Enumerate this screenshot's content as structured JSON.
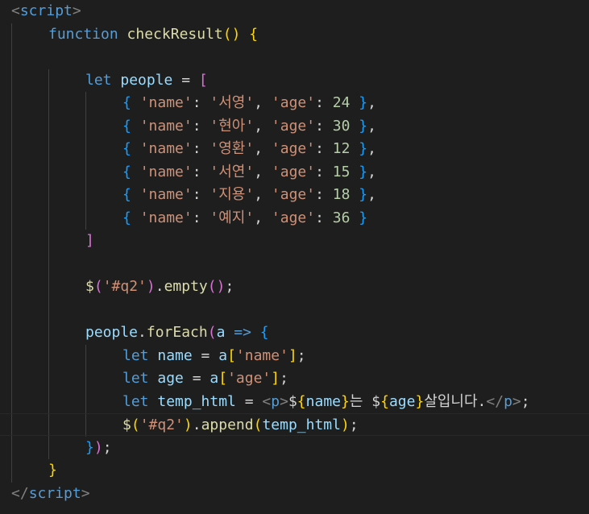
{
  "editor": {
    "colors": {
      "background": "#1e1e1e",
      "tag_bracket": "#808080",
      "tag": "#569cd6",
      "keyword": "#569cd6",
      "function": "#dcdcaa",
      "variable": "#9cdcfe",
      "string": "#ce9178",
      "number": "#b5cea8",
      "text": "#d4d4d4",
      "bracket_gold": "#ffd700",
      "bracket_purple": "#da70d6",
      "bracket_blue": "#179fff"
    },
    "lines": [
      {
        "indent": 0,
        "tokens": [
          {
            "t": "<",
            "c": "tag_bracket"
          },
          {
            "t": "script",
            "c": "tag"
          },
          {
            "t": ">",
            "c": "tag_bracket"
          }
        ]
      },
      {
        "indent": 1,
        "tokens": [
          {
            "t": "function",
            "c": "keyword"
          },
          {
            "t": " ",
            "c": "text"
          },
          {
            "t": "checkResult",
            "c": "function"
          },
          {
            "t": "()",
            "c": "bracket_gold"
          },
          {
            "t": " ",
            "c": "text"
          },
          {
            "t": "{",
            "c": "bracket_gold"
          }
        ]
      },
      {
        "indent": 0,
        "tokens": []
      },
      {
        "indent": 2,
        "tokens": [
          {
            "t": "let",
            "c": "keyword"
          },
          {
            "t": " ",
            "c": "text"
          },
          {
            "t": "people",
            "c": "variable"
          },
          {
            "t": " = ",
            "c": "text"
          },
          {
            "t": "[",
            "c": "bracket_purple"
          }
        ]
      },
      {
        "indent": 3,
        "tokens": [
          {
            "t": "{",
            "c": "bracket_blue"
          },
          {
            "t": " ",
            "c": "text"
          },
          {
            "t": "'name'",
            "c": "string"
          },
          {
            "t": ": ",
            "c": "text"
          },
          {
            "t": "'서영'",
            "c": "string"
          },
          {
            "t": ", ",
            "c": "text"
          },
          {
            "t": "'age'",
            "c": "string"
          },
          {
            "t": ": ",
            "c": "text"
          },
          {
            "t": "24",
            "c": "number"
          },
          {
            "t": " ",
            "c": "text"
          },
          {
            "t": "}",
            "c": "bracket_blue"
          },
          {
            "t": ",",
            "c": "text"
          }
        ]
      },
      {
        "indent": 3,
        "tokens": [
          {
            "t": "{",
            "c": "bracket_blue"
          },
          {
            "t": " ",
            "c": "text"
          },
          {
            "t": "'name'",
            "c": "string"
          },
          {
            "t": ": ",
            "c": "text"
          },
          {
            "t": "'현아'",
            "c": "string"
          },
          {
            "t": ", ",
            "c": "text"
          },
          {
            "t": "'age'",
            "c": "string"
          },
          {
            "t": ": ",
            "c": "text"
          },
          {
            "t": "30",
            "c": "number"
          },
          {
            "t": " ",
            "c": "text"
          },
          {
            "t": "}",
            "c": "bracket_blue"
          },
          {
            "t": ",",
            "c": "text"
          }
        ]
      },
      {
        "indent": 3,
        "tokens": [
          {
            "t": "{",
            "c": "bracket_blue"
          },
          {
            "t": " ",
            "c": "text"
          },
          {
            "t": "'name'",
            "c": "string"
          },
          {
            "t": ": ",
            "c": "text"
          },
          {
            "t": "'영환'",
            "c": "string"
          },
          {
            "t": ", ",
            "c": "text"
          },
          {
            "t": "'age'",
            "c": "string"
          },
          {
            "t": ": ",
            "c": "text"
          },
          {
            "t": "12",
            "c": "number"
          },
          {
            "t": " ",
            "c": "text"
          },
          {
            "t": "}",
            "c": "bracket_blue"
          },
          {
            "t": ",",
            "c": "text"
          }
        ]
      },
      {
        "indent": 3,
        "tokens": [
          {
            "t": "{",
            "c": "bracket_blue"
          },
          {
            "t": " ",
            "c": "text"
          },
          {
            "t": "'name'",
            "c": "string"
          },
          {
            "t": ": ",
            "c": "text"
          },
          {
            "t": "'서연'",
            "c": "string"
          },
          {
            "t": ", ",
            "c": "text"
          },
          {
            "t": "'age'",
            "c": "string"
          },
          {
            "t": ": ",
            "c": "text"
          },
          {
            "t": "15",
            "c": "number"
          },
          {
            "t": " ",
            "c": "text"
          },
          {
            "t": "}",
            "c": "bracket_blue"
          },
          {
            "t": ",",
            "c": "text"
          }
        ]
      },
      {
        "indent": 3,
        "tokens": [
          {
            "t": "{",
            "c": "bracket_blue"
          },
          {
            "t": " ",
            "c": "text"
          },
          {
            "t": "'name'",
            "c": "string"
          },
          {
            "t": ": ",
            "c": "text"
          },
          {
            "t": "'지용'",
            "c": "string"
          },
          {
            "t": ", ",
            "c": "text"
          },
          {
            "t": "'age'",
            "c": "string"
          },
          {
            "t": ": ",
            "c": "text"
          },
          {
            "t": "18",
            "c": "number"
          },
          {
            "t": " ",
            "c": "text"
          },
          {
            "t": "}",
            "c": "bracket_blue"
          },
          {
            "t": ",",
            "c": "text"
          }
        ]
      },
      {
        "indent": 3,
        "tokens": [
          {
            "t": "{",
            "c": "bracket_blue"
          },
          {
            "t": " ",
            "c": "text"
          },
          {
            "t": "'name'",
            "c": "string"
          },
          {
            "t": ": ",
            "c": "text"
          },
          {
            "t": "'예지'",
            "c": "string"
          },
          {
            "t": ", ",
            "c": "text"
          },
          {
            "t": "'age'",
            "c": "string"
          },
          {
            "t": ": ",
            "c": "text"
          },
          {
            "t": "36",
            "c": "number"
          },
          {
            "t": " ",
            "c": "text"
          },
          {
            "t": "}",
            "c": "bracket_blue"
          }
        ]
      },
      {
        "indent": 2,
        "tokens": [
          {
            "t": "]",
            "c": "bracket_purple"
          }
        ]
      },
      {
        "indent": 0,
        "tokens": []
      },
      {
        "indent": 2,
        "tokens": [
          {
            "t": "$",
            "c": "function"
          },
          {
            "t": "(",
            "c": "bracket_purple"
          },
          {
            "t": "'#q2'",
            "c": "string"
          },
          {
            "t": ")",
            "c": "bracket_purple"
          },
          {
            "t": ".",
            "c": "text"
          },
          {
            "t": "empty",
            "c": "function"
          },
          {
            "t": "()",
            "c": "bracket_purple"
          },
          {
            "t": ";",
            "c": "text"
          }
        ]
      },
      {
        "indent": 0,
        "tokens": []
      },
      {
        "indent": 2,
        "tokens": [
          {
            "t": "people",
            "c": "variable"
          },
          {
            "t": ".",
            "c": "text"
          },
          {
            "t": "forEach",
            "c": "function"
          },
          {
            "t": "(",
            "c": "bracket_purple"
          },
          {
            "t": "a",
            "c": "variable"
          },
          {
            "t": " ",
            "c": "text"
          },
          {
            "t": "=>",
            "c": "keyword"
          },
          {
            "t": " ",
            "c": "text"
          },
          {
            "t": "{",
            "c": "bracket_blue"
          }
        ]
      },
      {
        "indent": 3,
        "tokens": [
          {
            "t": "let",
            "c": "keyword"
          },
          {
            "t": " ",
            "c": "text"
          },
          {
            "t": "name",
            "c": "variable"
          },
          {
            "t": " = ",
            "c": "text"
          },
          {
            "t": "a",
            "c": "variable"
          },
          {
            "t": "[",
            "c": "bracket_gold"
          },
          {
            "t": "'name'",
            "c": "string"
          },
          {
            "t": "]",
            "c": "bracket_gold"
          },
          {
            "t": ";",
            "c": "text"
          }
        ]
      },
      {
        "indent": 3,
        "tokens": [
          {
            "t": "let",
            "c": "keyword"
          },
          {
            "t": " ",
            "c": "text"
          },
          {
            "t": "age",
            "c": "variable"
          },
          {
            "t": " = ",
            "c": "text"
          },
          {
            "t": "a",
            "c": "variable"
          },
          {
            "t": "[",
            "c": "bracket_gold"
          },
          {
            "t": "'age'",
            "c": "string"
          },
          {
            "t": "]",
            "c": "bracket_gold"
          },
          {
            "t": ";",
            "c": "text"
          }
        ]
      },
      {
        "indent": 3,
        "tokens": [
          {
            "t": "let",
            "c": "keyword"
          },
          {
            "t": " ",
            "c": "text"
          },
          {
            "t": "temp_html",
            "c": "variable"
          },
          {
            "t": " = ",
            "c": "text"
          },
          {
            "t": "<",
            "c": "tag_bracket"
          },
          {
            "t": "p",
            "c": "tag"
          },
          {
            "t": ">",
            "c": "tag_bracket"
          },
          {
            "t": "$",
            "c": "text"
          },
          {
            "t": "{",
            "c": "bracket_gold"
          },
          {
            "t": "name",
            "c": "variable"
          },
          {
            "t": "}",
            "c": "bracket_gold"
          },
          {
            "t": "는 ",
            "c": "text"
          },
          {
            "t": "$",
            "c": "text"
          },
          {
            "t": "{",
            "c": "bracket_gold"
          },
          {
            "t": "age",
            "c": "variable"
          },
          {
            "t": "}",
            "c": "bracket_gold"
          },
          {
            "t": "살입니다.",
            "c": "text"
          },
          {
            "t": "</",
            "c": "tag_bracket"
          },
          {
            "t": "p",
            "c": "tag"
          },
          {
            "t": ">",
            "c": "tag_bracket"
          },
          {
            "t": ";",
            "c": "text"
          }
        ]
      },
      {
        "indent": 3,
        "current": true,
        "tokens": [
          {
            "t": "$",
            "c": "function"
          },
          {
            "t": "(",
            "c": "bracket_gold"
          },
          {
            "t": "'#q2'",
            "c": "string"
          },
          {
            "t": ")",
            "c": "bracket_gold"
          },
          {
            "t": ".",
            "c": "text"
          },
          {
            "t": "append",
            "c": "function"
          },
          {
            "t": "(",
            "c": "bracket_gold"
          },
          {
            "t": "temp_html",
            "c": "variable"
          },
          {
            "t": ")",
            "c": "bracket_gold"
          },
          {
            "t": ";",
            "c": "text"
          }
        ]
      },
      {
        "indent": 2,
        "tokens": [
          {
            "t": "}",
            "c": "bracket_blue"
          },
          {
            "t": ")",
            "c": "bracket_purple"
          },
          {
            "t": ";",
            "c": "text"
          }
        ]
      },
      {
        "indent": 1,
        "tokens": [
          {
            "t": "}",
            "c": "bracket_gold"
          }
        ]
      },
      {
        "indent": 0,
        "tokens": [
          {
            "t": "</",
            "c": "tag_bracket"
          },
          {
            "t": "script",
            "c": "tag"
          },
          {
            "t": ">",
            "c": "tag_bracket"
          }
        ]
      }
    ]
  }
}
